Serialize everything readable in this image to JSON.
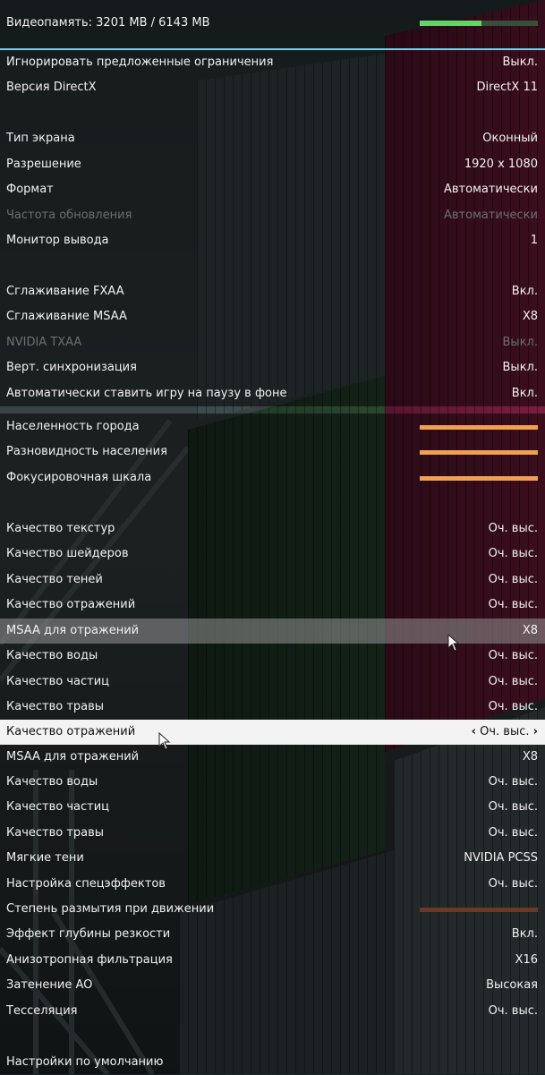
{
  "vram": {
    "label": "Видеопамять: 3201 MB / 6143 MB",
    "fraction": 0.5211
  },
  "rows": [
    {
      "label": "Игнорировать предложенные ограничения",
      "value": "Выкл."
    },
    {
      "label": "Версия DirectX",
      "value": "DirectX 11"
    },
    {
      "label": "Тип экрана",
      "value": "Оконный"
    },
    {
      "label": "Разрешение",
      "value": "1920 x 1080"
    },
    {
      "label": "Формат",
      "value": "Автоматически"
    },
    {
      "label": "Частота обновления",
      "value": "Автоматически"
    },
    {
      "label": "Монитор вывода",
      "value": "1"
    },
    {
      "label": "Сглаживание FXAA",
      "value": "Вкл."
    },
    {
      "label": "Сглаживание MSAA",
      "value": "X8"
    },
    {
      "label": "NVIDIA TXAA",
      "value": "Выкл."
    },
    {
      "label": "Верт. синхронизация",
      "value": "Выкл."
    },
    {
      "label": "Автоматически ставить игру на паузу в фоне",
      "value": "Вкл."
    },
    {
      "label": "Населенность города",
      "level": 1.0
    },
    {
      "label": "Разновидность населения",
      "level": 1.0
    },
    {
      "label": "Фокусировочная шкала",
      "level": 1.0
    },
    {
      "label": "Качество текстур",
      "value": "Оч. выс."
    },
    {
      "label": "Качество шейдеров",
      "value": "Оч. выс."
    },
    {
      "label": "Качество теней",
      "value": "Оч. выс."
    },
    {
      "label": "Качество отражений",
      "value": "Оч. выс."
    },
    {
      "label": "MSAA для отражений",
      "value": "X8"
    },
    {
      "label": "Качество воды",
      "value": "Оч. выс."
    },
    {
      "label": "Качество частиц",
      "value": "Оч. выс."
    },
    {
      "label": "Качество травы",
      "value": "Оч. выс."
    },
    {
      "label": "Качество отражений",
      "value": "Оч. выс."
    },
    {
      "label": "MSAA для отражений",
      "value": "X8"
    },
    {
      "label": "Качество воды",
      "value": "Оч. выс."
    },
    {
      "label": "Качество частиц",
      "value": "Оч. выс."
    },
    {
      "label": "Качество травы",
      "value": "Оч. выс."
    },
    {
      "label": "Мягкие тени",
      "value": "NVIDIA PCSS"
    },
    {
      "label": "Настройка спецэффектов",
      "value": "Оч. выс."
    },
    {
      "label": "Степень размытия при движении",
      "level": 1.0
    },
    {
      "label": "Эффект глубины резкости",
      "value": "Вкл."
    },
    {
      "label": "Анизотропная фильтрация",
      "value": "X16"
    },
    {
      "label": "Затенение AO",
      "value": "Высокая"
    },
    {
      "label": "Тесселяция",
      "value": "Оч. выс."
    },
    {
      "label": "Настройки по умолчанию"
    }
  ],
  "arrows": {
    "left": "‹",
    "right": "›"
  },
  "colors": {
    "accent_line": "#7ccfe6",
    "vram_fill": "#66d36a",
    "slider": "#f0a050",
    "slider_dim": "#6a3a25"
  }
}
